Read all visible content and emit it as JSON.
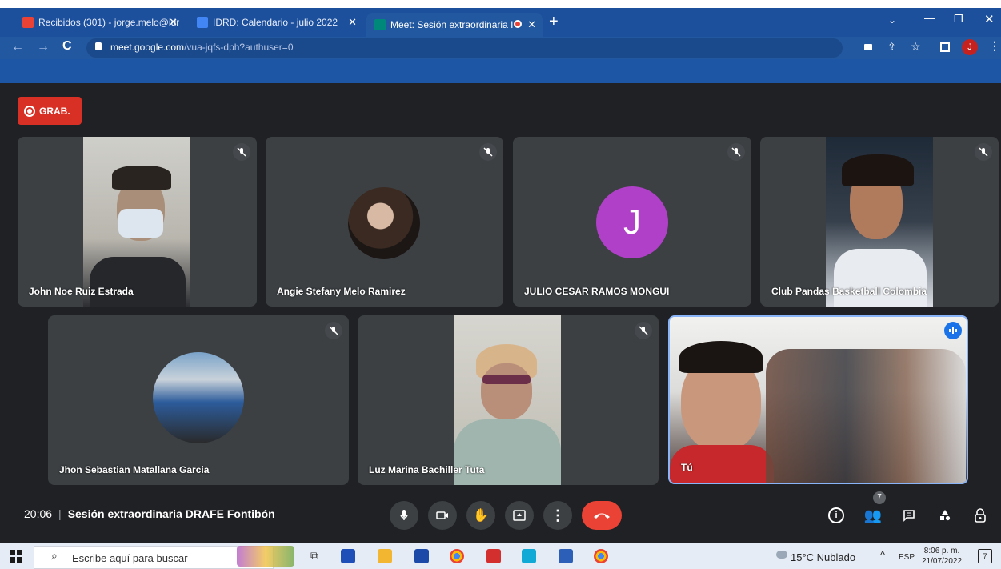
{
  "browser": {
    "tabs": [
      {
        "label": "Recibidos (301) - jorge.melo@idr",
        "icon": "gmail-icon",
        "color": "#ea4335"
      },
      {
        "label": "IDRD: Calendario - julio 2022",
        "icon": "calendar-icon",
        "color": "#4285f4"
      },
      {
        "label": "Meet: Sesión extraordinaria I",
        "icon": "meet-icon",
        "color": "#00897b"
      }
    ],
    "new_tab": "+",
    "url_host": "meet.google.com",
    "url_path": "/vua-jqfs-dph?authuser=0",
    "profile_initial": "J"
  },
  "meeting": {
    "recording_label": "GRAB.",
    "time": "20:06",
    "title": "Sesión extraordinaria DRAFE Fontibón",
    "participant_count": "7",
    "participants": [
      {
        "name": "John Noe Ruiz Estrada",
        "type": "video",
        "muted": true
      },
      {
        "name": "Angie Stefany Melo Ramirez",
        "type": "avatar-photo",
        "muted": true
      },
      {
        "name": "JULIO CESAR RAMOS MONGUI",
        "type": "initial",
        "initial": "J",
        "muted": true
      },
      {
        "name": "Club Pandas Basketball Colombia",
        "type": "video",
        "muted": true
      },
      {
        "name": "Jhon Sebastian Matallana Garcia",
        "type": "avatar-photo",
        "muted": true
      },
      {
        "name": "Luz Marina Bachiller Tuta",
        "type": "video",
        "muted": true
      },
      {
        "name": "Tú",
        "type": "video",
        "speaking": true
      }
    ]
  },
  "colors": {
    "accent": "#8ab4f8",
    "record": "#d93025",
    "hangup": "#ea4335",
    "initial_avatar": "#b040c8"
  },
  "taskbar": {
    "search_placeholder": "Escribe aquí para buscar",
    "weather": "15°C  Nublado",
    "lang": "ESP",
    "time": "8:06 p. m.",
    "date": "21/07/2022",
    "notif_count": "7"
  }
}
